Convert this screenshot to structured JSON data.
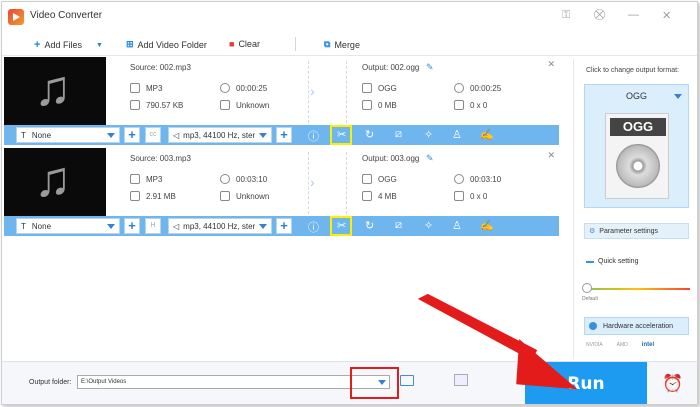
{
  "window": {
    "title": "Video Converter"
  },
  "toolbar": {
    "add_files": "Add Files",
    "add_video_folder": "Add Video Folder",
    "clear": "Clear",
    "merge": "Merge"
  },
  "items": [
    {
      "source_name": "Source: 002.mp3",
      "src_format": "MP3",
      "src_duration": "00:00:25",
      "src_size": "790.57 KB",
      "src_res": "Unknown",
      "output_name": "Output: 002.ogg",
      "out_format": "OGG",
      "out_duration": "00:00:25",
      "out_size": "0 MB",
      "out_res": "0 x 0",
      "subtitle": "None",
      "audio": "mp3, 44100 Hz, ster"
    },
    {
      "source_name": "Source: 003.mp3",
      "src_format": "MP3",
      "src_duration": "00:03:10",
      "src_size": "2.91 MB",
      "src_res": "Unknown",
      "output_name": "Output: 003.ogg",
      "out_format": "OGG",
      "out_duration": "00:03:10",
      "out_size": "4 MB",
      "out_res": "0 x 0",
      "subtitle": "None",
      "audio": "mp3, 44100 Hz, ster"
    }
  ],
  "right_panel": {
    "change_format_label": "Click to change output format:",
    "format": "OGG",
    "format_image_label": "OGG",
    "parameter_settings": "Parameter settings",
    "quick_setting": "Quick setting",
    "default_label": "Default",
    "hardware_acceleration": "Hardware acceleration",
    "vendors": [
      "NVIDIA",
      "AMD",
      "intel"
    ]
  },
  "bottom": {
    "output_folder_label": "Output folder:",
    "output_folder_value": "E:\\Output Videos",
    "run_label": "Run"
  },
  "colors": {
    "accent": "#1d9bf0",
    "item_bar": "#6fb6ee",
    "highlight_yellow": "#f6f200",
    "annotation_red": "#e41b1b"
  }
}
